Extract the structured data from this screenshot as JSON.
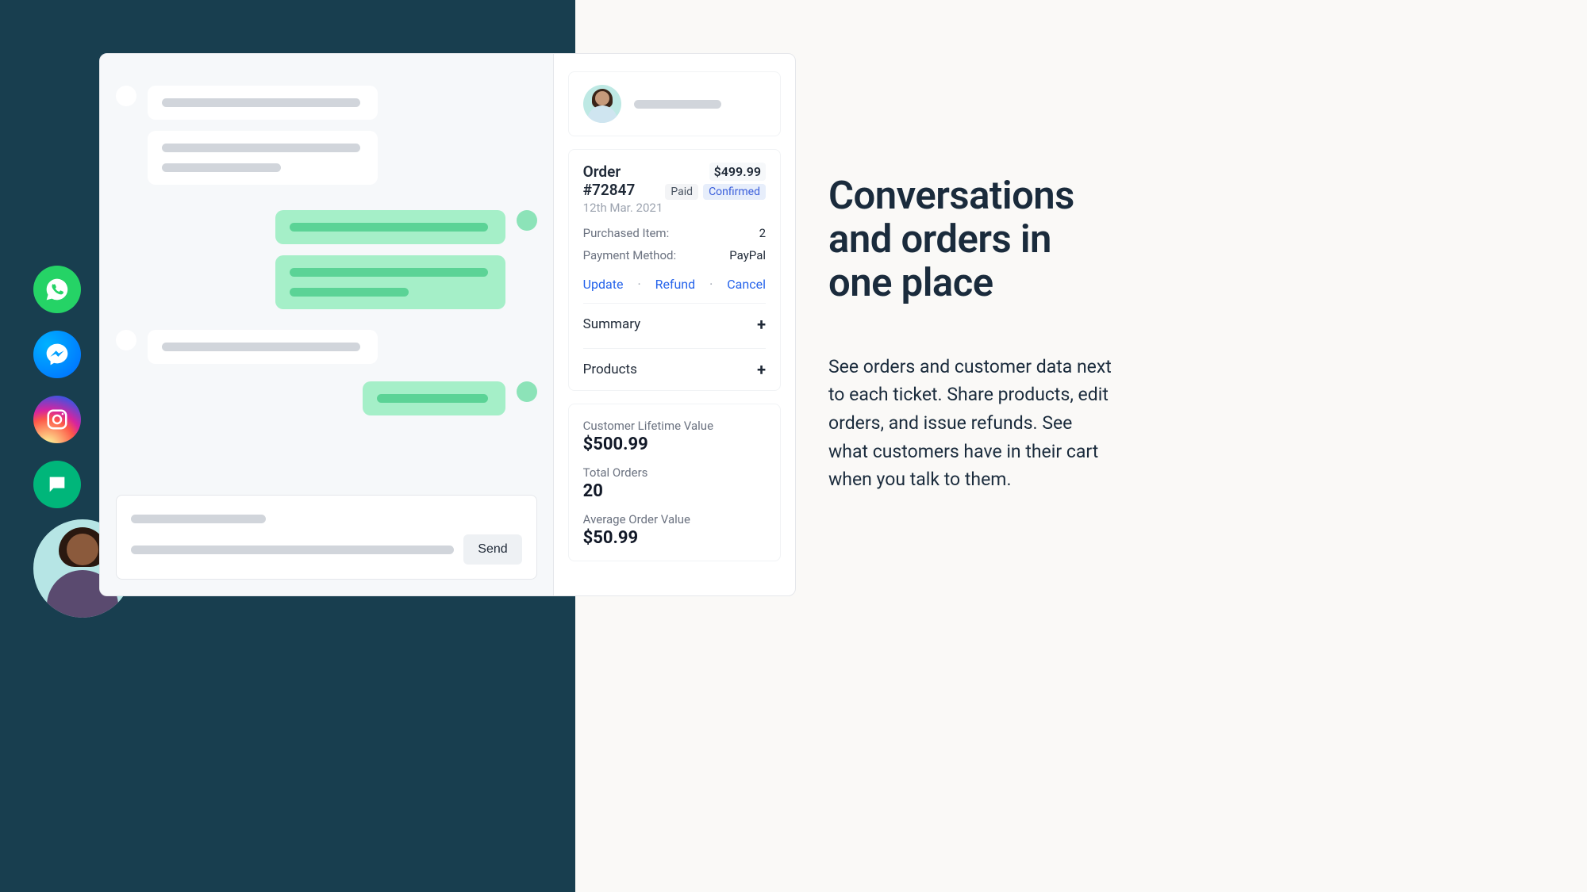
{
  "channels": [
    "whatsapp",
    "messenger",
    "instagram",
    "chat"
  ],
  "composer": {
    "send_label": "Send"
  },
  "order": {
    "title": "Order #72847",
    "date": "12th Mar. 2021",
    "price": "$499.99",
    "badge_paid": "Paid",
    "badge_confirmed": "Confirmed",
    "purchased_label": "Purchased Item:",
    "purchased_value": "2",
    "payment_label": "Payment Method:",
    "payment_value": "PayPal",
    "action_update": "Update",
    "action_refund": "Refund",
    "action_cancel": "Cancel",
    "accordion_summary": "Summary",
    "accordion_products": "Products"
  },
  "stats": {
    "clv_label": "Customer Lifetime Value",
    "clv_value": "$500.99",
    "total_label": "Total Orders",
    "total_value": "20",
    "aov_label": "Average Order Value",
    "aov_value": "$50.99"
  },
  "hero": {
    "title": "Conversations and orders in one place",
    "body": "See orders and customer data next to each ticket. Share products, edit orders, and issue refunds. See what customers have in their cart when you talk to them."
  }
}
